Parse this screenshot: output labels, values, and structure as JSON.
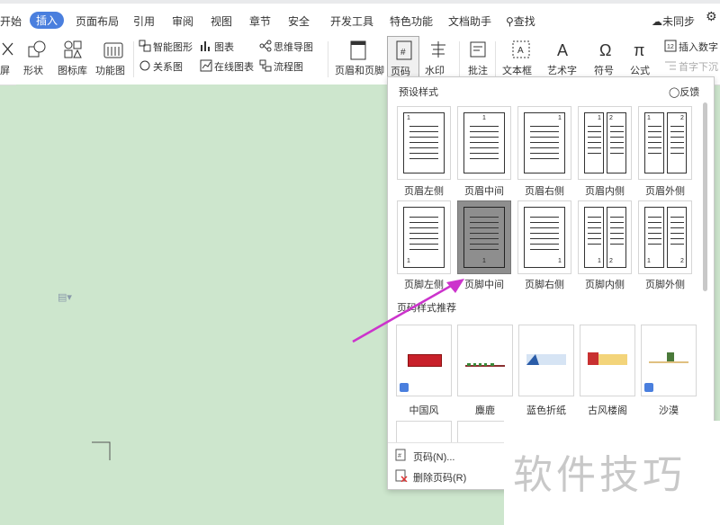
{
  "menubar": {
    "tabs": [
      "开始",
      "插入",
      "页面布局",
      "引用",
      "审阅",
      "视图",
      "章节",
      "安全",
      "开发工具",
      "特色功能",
      "文档助手"
    ],
    "active": "插入",
    "search": "查找",
    "sync": "未同步"
  },
  "toolbar": {
    "screen": "屏",
    "shape": "形状",
    "icon_lib": "图标库",
    "func_chart": "功能图",
    "smart_shape": "智能图形",
    "chart": "图表",
    "relation": "关系图",
    "online_chart": "在线图表",
    "mindmap": "思维导图",
    "flowchart": "流程图",
    "header_footer": "页眉和页脚",
    "page_num": "页码",
    "watermark": "水印",
    "comment": "批注",
    "textbox": "文本框",
    "art_text": "艺术字",
    "symbol": "符号",
    "formula": "公式",
    "insert_number": "插入数字",
    "drop_cap": "首字下沉"
  },
  "panel": {
    "preset_title": "预设样式",
    "feedback": "反馈",
    "header_styles": [
      "页眉左侧",
      "页眉中间",
      "页眉右侧",
      "页眉内侧",
      "页眉外侧"
    ],
    "footer_styles": [
      "页脚左侧",
      "页脚中间",
      "页脚右侧",
      "页脚内侧",
      "页脚外侧"
    ],
    "recommend_title": "页码样式推荐",
    "recommend": [
      "中国风",
      "麋鹿",
      "蓝色折纸",
      "古风楼阁",
      "沙漠"
    ],
    "menu_page_num": "页码(N)...",
    "menu_delete": "删除页码(R)"
  },
  "watermark_text": "软件技巧",
  "colors": {
    "accent": "#4a7fde",
    "doc_bg": "#cde6cd",
    "arrow": "#cc33cc"
  }
}
